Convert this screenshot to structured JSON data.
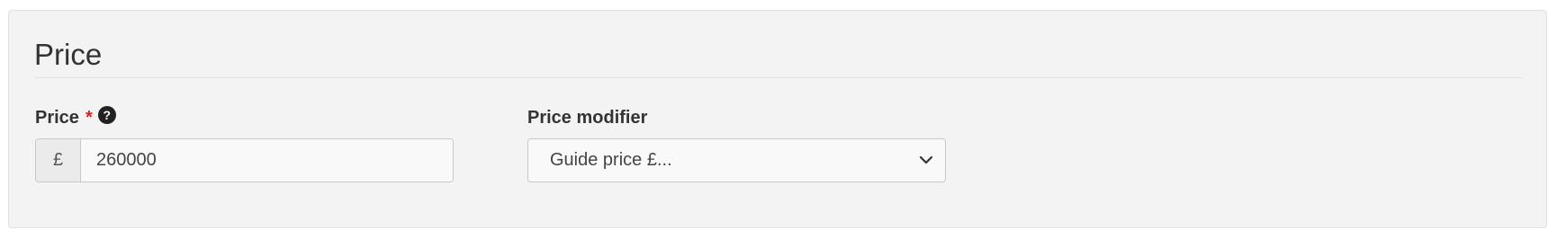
{
  "section": {
    "title": "Price"
  },
  "price_field": {
    "label": "Price",
    "required_marker": "*",
    "help_icon_glyph": "?",
    "currency_symbol": "£",
    "value": "260000"
  },
  "modifier_field": {
    "label": "Price modifier",
    "selected_option": "Guide price £..."
  },
  "icons": {
    "help": "question-circle-icon",
    "dropdown": "chevron-down-icon"
  },
  "colors": {
    "panel_background": "#f3f3f3",
    "required": "#e02020",
    "text": "#333333"
  }
}
